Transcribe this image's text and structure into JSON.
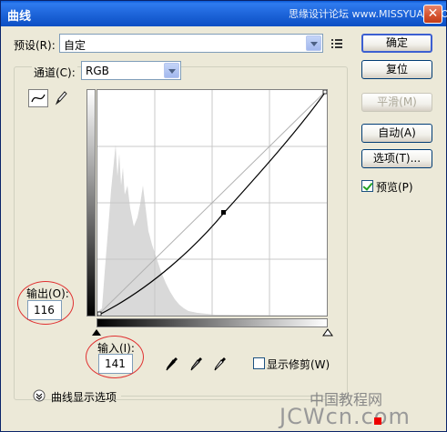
{
  "title": "曲线",
  "watermark_top": "思缘设计论坛 www.MISSYUAN.COM",
  "preset": {
    "label": "预设(R):",
    "value": "自定"
  },
  "channel": {
    "label": "通道(C):",
    "value": "RGB"
  },
  "buttons": {
    "ok": "确定",
    "reset": "复位",
    "smooth": "平滑(M)",
    "auto": "自动(A)",
    "options": "选项(T)..."
  },
  "preview": {
    "label": "预览(P)",
    "checked": true
  },
  "output": {
    "label": "输出(O):",
    "value": "116"
  },
  "input": {
    "label": "输入(I):",
    "value": "141"
  },
  "show_clipping": {
    "label": "显示修剪(W)",
    "checked": false
  },
  "curve_display_options": "曲线显示选项",
  "watermark_bottom": "中国教程网",
  "watermark_bottom2": "JCWcn.com",
  "curve": {
    "point_input": 141,
    "point_output": 116
  }
}
